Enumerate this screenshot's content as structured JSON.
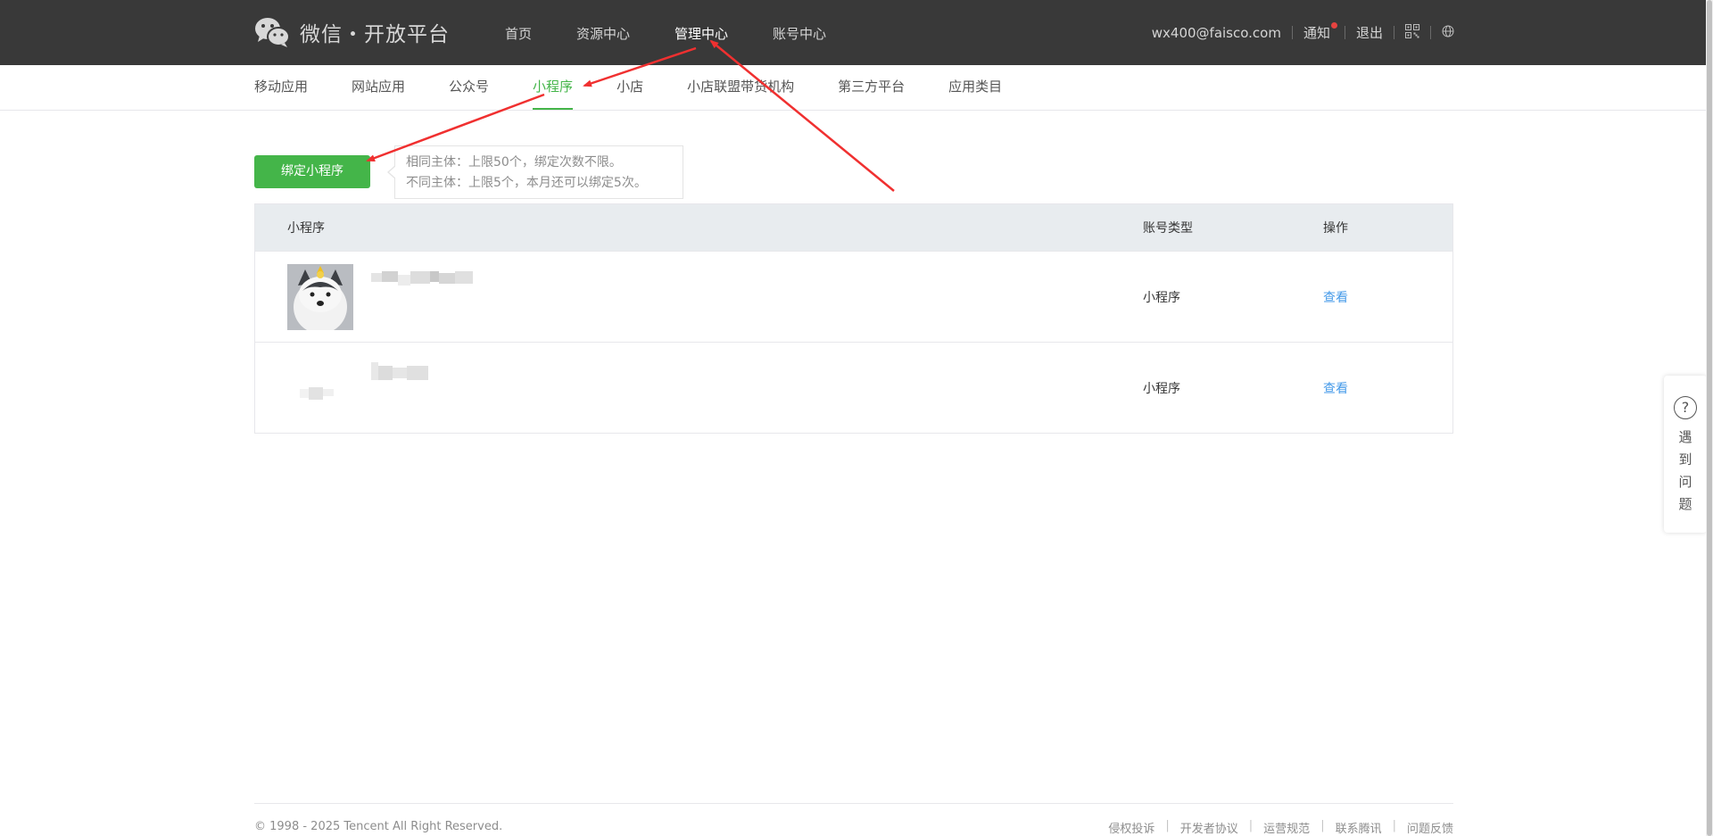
{
  "header": {
    "logo_text": "微信・开放平台",
    "nav": [
      {
        "label": "首页",
        "active": false
      },
      {
        "label": "资源中心",
        "active": false
      },
      {
        "label": "管理中心",
        "active": true
      },
      {
        "label": "账号中心",
        "active": false
      }
    ],
    "user_email": "wx400@faisco.com",
    "notice_label": "通知",
    "logout_label": "退出",
    "qr_icon": "qrcode-icon",
    "lang_icon": "globe-icon"
  },
  "subnav": {
    "items": [
      {
        "label": "移动应用",
        "active": false
      },
      {
        "label": "网站应用",
        "active": false
      },
      {
        "label": "公众号",
        "active": false
      },
      {
        "label": "小程序",
        "active": true
      },
      {
        "label": "小店",
        "active": false
      },
      {
        "label": "小店联盟带货机构",
        "active": false
      },
      {
        "label": "第三方平台",
        "active": false
      },
      {
        "label": "应用类目",
        "active": false
      }
    ]
  },
  "bind": {
    "button_label": "绑定小程序",
    "tip_line1": "相同主体：上限50个，绑定次数不限。",
    "tip_line2": "不同主体：上限5个，本月还可以绑定5次。"
  },
  "table": {
    "headers": {
      "name": "小程序",
      "type": "账号类型",
      "op": "操作"
    },
    "rows": [
      {
        "type": "小程序",
        "op": "查看"
      },
      {
        "type": "小程序",
        "op": "查看"
      }
    ]
  },
  "help": {
    "chars": [
      "遇",
      "到",
      "问",
      "题"
    ]
  },
  "footer": {
    "copyright": "© 1998 - 2025 Tencent All Right Reserved.",
    "links": [
      "侵权投诉",
      "开发者协议",
      "运营规范",
      "联系腾讯",
      "问题反馈"
    ]
  },
  "colors": {
    "topbar": "#393939",
    "accent_green": "#44b549",
    "link_blue": "#459ae9",
    "arrow_red": "#f03030"
  }
}
